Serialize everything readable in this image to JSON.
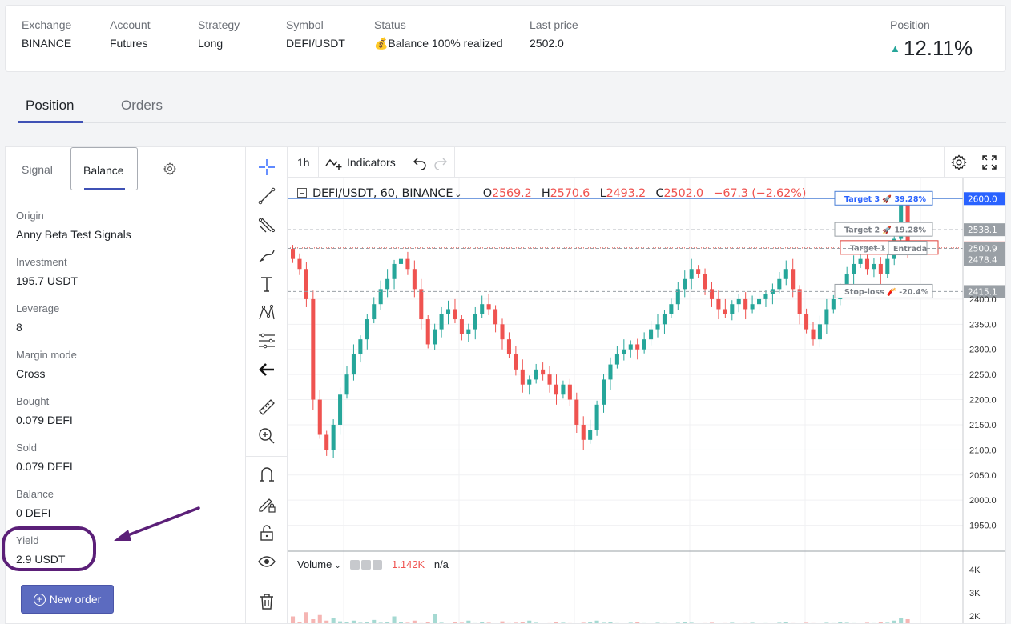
{
  "header": {
    "fields": [
      {
        "label": "Exchange",
        "value": "BINANCE"
      },
      {
        "label": "Account",
        "value": "Futures"
      },
      {
        "label": "Strategy",
        "value": "Long"
      },
      {
        "label": "Symbol",
        "value": "DEFI/USDT"
      },
      {
        "label": "Status",
        "value": "💰Balance 100% realized"
      },
      {
        "label": "Last price",
        "value": "2502.0"
      }
    ],
    "position_label": "Position",
    "position_value": "12.11%"
  },
  "page_tabs": {
    "position": "Position",
    "orders": "Orders"
  },
  "left_panel": {
    "tabs": {
      "signal": "Signal",
      "balance": "Balance"
    },
    "fields": [
      {
        "label": "Origin",
        "value": "Anny Beta Test Signals"
      },
      {
        "label": "Investment",
        "value": "195.7 USDT"
      },
      {
        "label": "Leverage",
        "value": "8"
      },
      {
        "label": "Margin mode",
        "value": "Cross"
      },
      {
        "label": "Bought",
        "value": "0.079 DEFI"
      },
      {
        "label": "Sold",
        "value": "0.079 DEFI"
      },
      {
        "label": "Balance",
        "value": "0 DEFI"
      },
      {
        "label": "Yield",
        "value": "2.9 USDT"
      }
    ],
    "new_order_label": "New order"
  },
  "chart_toolbar": {
    "interval": "1h",
    "indicators": "Indicators"
  },
  "chart_legend": {
    "symbol": "DEFI/USDT, 60, BINANCE",
    "o_label": "O",
    "o_value": "2569.2",
    "h_label": "H",
    "h_value": "2570.6",
    "l_label": "L",
    "l_value": "2493.2",
    "c_label": "C",
    "c_value": "2502.0",
    "change": "−67.3 (−2.62%)"
  },
  "volume_legend": {
    "label": "Volume",
    "value": "1.142K",
    "na": "n/a"
  },
  "chart_data": {
    "type": "candlestick",
    "price_axis": {
      "ticks": [
        1950.0,
        2000.0,
        2050.0,
        2100.0,
        2150.0,
        2200.0,
        2250.0,
        2300.0,
        2350.0,
        2400.0
      ],
      "ylim": [
        1900,
        2610
      ]
    },
    "volume_axis": {
      "ticks": [
        "4K",
        "3K",
        "2K"
      ]
    },
    "price_levels": [
      {
        "label": "Target 3 🚀 39.28%",
        "price": "2600.0",
        "color": "#4a7fd6",
        "style": "solid"
      },
      {
        "label": "Target 2 🚀 19.28%",
        "price": "2538.1",
        "color": "#9aa0a6",
        "style": "dashed"
      },
      {
        "label": "Target 1 🚀 7.28%",
        "price": "2502.0",
        "color": "#e0403a",
        "style": "dotted"
      },
      {
        "label": "Entrada",
        "price": "2500.9",
        "color": "#9aa0a6",
        "style": "dashed"
      },
      {
        "label": "",
        "price": "2478.4",
        "color": "#9aa0a6",
        "style": "none"
      },
      {
        "label": "Stop-loss 🧨 -20.4%",
        "price": "2415.1",
        "color": "#9aa0a6",
        "style": "dashed"
      }
    ],
    "closes": [
      2480,
      2460,
      2400,
      2200,
      2130,
      2100,
      2150,
      2210,
      2250,
      2290,
      2320,
      2360,
      2390,
      2420,
      2440,
      2470,
      2480,
      2460,
      2420,
      2360,
      2310,
      2340,
      2370,
      2380,
      2360,
      2330,
      2340,
      2370,
      2390,
      2380,
      2350,
      2320,
      2290,
      2260,
      2230,
      2240,
      2260,
      2250,
      2230,
      2210,
      2230,
      2200,
      2150,
      2120,
      2140,
      2190,
      2240,
      2270,
      2290,
      2300,
      2310,
      2300,
      2320,
      2340,
      2350,
      2370,
      2390,
      2420,
      2440,
      2460,
      2450,
      2420,
      2400,
      2380,
      2370,
      2390,
      2400,
      2380,
      2390,
      2400,
      2410,
      2420,
      2440,
      2460,
      2420,
      2370,
      2340,
      2320,
      2350,
      2380,
      2400,
      2420,
      2450,
      2470,
      2480,
      2460,
      2470,
      2450,
      2480,
      2520,
      2590,
      2502
    ],
    "volumes": [
      600,
      200,
      900,
      400,
      700,
      300,
      500,
      250,
      200,
      300,
      150,
      200,
      350,
      150,
      200,
      600,
      200,
      150,
      300,
      120,
      200,
      800,
      150,
      100,
      200,
      150,
      300,
      120,
      200,
      150,
      100,
      250,
      120,
      150,
      200,
      300,
      150,
      100,
      120,
      200,
      150,
      120,
      100,
      150,
      200,
      300,
      150,
      200,
      120,
      100,
      150,
      200,
      120,
      100,
      150,
      120,
      100,
      150,
      200,
      150,
      100,
      120,
      150,
      100,
      120,
      150,
      100,
      120,
      150,
      100,
      120,
      100,
      150,
      200,
      120,
      100,
      150,
      120,
      100,
      150,
      120,
      200,
      150,
      120,
      100,
      150,
      120,
      200,
      150,
      300,
      500,
      400
    ]
  }
}
